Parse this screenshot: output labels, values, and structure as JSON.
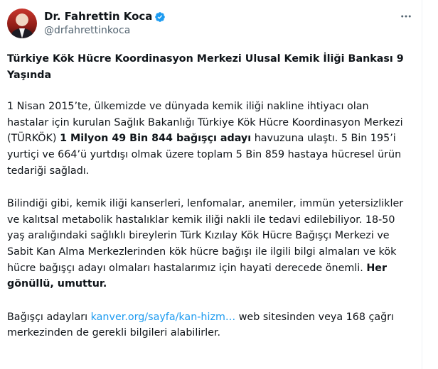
{
  "author": {
    "name": "Dr. Fahrettin Koca",
    "handle": "@drfahrettinkoca"
  },
  "icons": {
    "verified": "verified-badge-icon",
    "more": "more-options-icon"
  },
  "colors": {
    "link": "#1d9bf0",
    "secondary_text": "#536471"
  },
  "tweet": {
    "title": "Türkiye Kök Hücre Koordinasyon Merkezi Ulusal Kemik İliği Bankası 9 Yaşında",
    "p1": {
      "text_a": "1 Nisan 2015’te, ülkemizde ve dünyada kemik iliği nakline ihtiyacı olan hastalar için kurulan Sağlık Bakanlığı Türkiye Kök Hücre Koordinasyon Merkezi (TÜRKÖK) ",
      "bold": "1 Milyon 49 Bin 844 bağışçı adayı",
      "text_b": " havuzuna ulaştı. 5 Bin 195’i yurtiçi ve 664’ü yurtdışı olmak üzere toplam 5 Bin 859 hastaya hücresel ürün tedariği sağladı."
    },
    "p2": {
      "text_a": "Bilindiği gibi, kemik iliği kanserleri, lenfomalar, anemiler, immün yetersizlikler ve kalıtsal metabolik hastalıklar kemik iliği nakli ile tedavi edilebiliyor. 18-50 yaş aralığındaki sağlıklı bireylerin Türk Kızılay Kök Hücre Bağışçı Merkezi ve Sabit Kan Alma Merkezlerinden kök hücre bağışı ile ilgili bilgi almaları ve kök hücre bağışçı adayı olmaları hastalarımız için hayati derecede önemli. ",
      "bold": "Her gönüllü, umuttur."
    },
    "p3": {
      "text_a": "Bağışçı adayları ",
      "link": "kanver.org/sayfa/kan-hizm…",
      "text_b": " web sitesinden veya 168 çağrı merkezinden de gerekli bilgileri alabilirler."
    }
  }
}
